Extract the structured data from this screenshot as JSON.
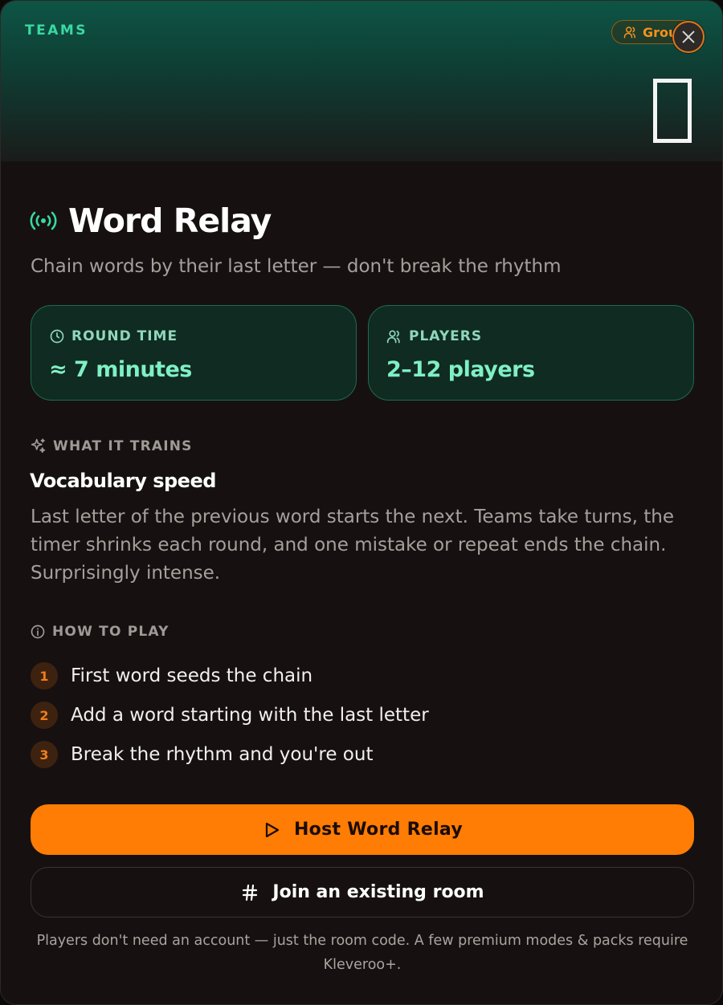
{
  "hero": {
    "category": "TEAMS",
    "badge_label": "Group",
    "accent_color": "#39d8a2",
    "badge_color": "#f6911c"
  },
  "game": {
    "title": "Word Relay",
    "subtitle": "Chain words by their last letter — don't break the rhythm"
  },
  "stats": [
    {
      "icon": "clock-icon",
      "label": "ROUND TIME",
      "value": "≈ 7 minutes"
    },
    {
      "icon": "users-icon",
      "label": "PLAYERS",
      "value": "2–12 players"
    }
  ],
  "trains": {
    "label": "WHAT IT TRAINS",
    "title": "Vocabulary speed",
    "description": "Last letter of the previous word starts the next. Teams take turns, the timer shrinks each round, and one mistake or repeat ends the chain. Surprisingly intense."
  },
  "how_to_play": {
    "label": "HOW TO PLAY",
    "steps": [
      {
        "num": "1",
        "text": "First word seeds the chain"
      },
      {
        "num": "2",
        "text": "Add a word starting with the last letter"
      },
      {
        "num": "3",
        "text": "Break the rhythm and you're out"
      }
    ]
  },
  "actions": {
    "host_label": "Host Word Relay",
    "join_label": "Join an existing room",
    "primary_color": "#ff7c05"
  },
  "footnote": "Players don't need an account — just the room code. A few premium modes & packs require Kleveroo+."
}
